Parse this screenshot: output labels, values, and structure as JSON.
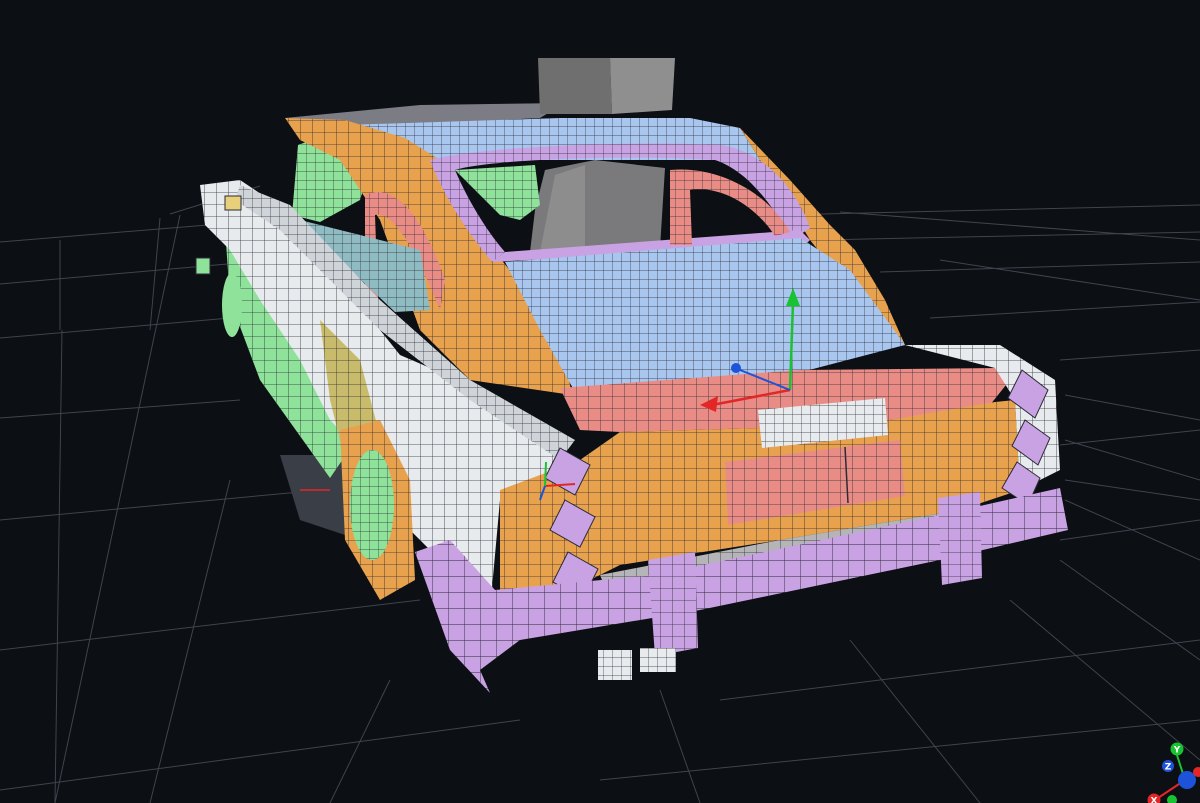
{
  "viewport": {
    "background": "#0c0f13",
    "grid_color": "#3e454f"
  },
  "model": {
    "colors": {
      "body_white": "#e8ebee",
      "orange": "#e8a24e",
      "salmon": "#ea8c86",
      "blue_glass": "#a8c6ee",
      "purple": "#c8a2e2",
      "green": "#8ee29a",
      "gray_block": "#6f6f70",
      "mesh_line": "#2b2b34"
    }
  },
  "gizmo": {
    "x_color": "#e32626",
    "y_color": "#19c230",
    "z_color": "#1c53d8"
  },
  "orientation_triad": {
    "x_label": "X",
    "y_label": "Y",
    "z_label": "Z"
  }
}
